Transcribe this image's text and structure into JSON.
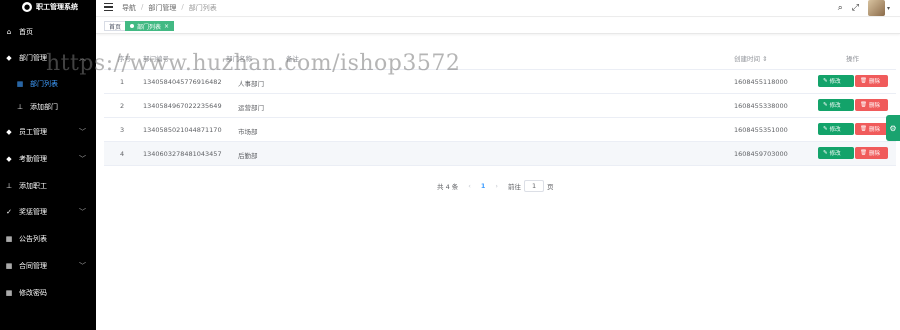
{
  "app": {
    "title": "职工管理系统"
  },
  "sidebar": {
    "items": [
      {
        "label": "首页",
        "icon": "home-icon",
        "glyph": "⌂"
      },
      {
        "label": "部门管理",
        "icon": "user-icon",
        "glyph": "👤"
      },
      {
        "label": "部门列表",
        "icon": "list-icon",
        "glyph": "▦"
      },
      {
        "label": "添加部门",
        "icon": "tree-icon",
        "glyph": "⊥"
      },
      {
        "label": "员工管理",
        "icon": "person-icon",
        "glyph": "👤"
      },
      {
        "label": "考勤管理",
        "icon": "person-icon",
        "glyph": "👤"
      },
      {
        "label": "添加职工",
        "icon": "tree-icon",
        "glyph": "⊥"
      },
      {
        "label": "奖惩管理",
        "icon": "check-icon",
        "glyph": "✓"
      },
      {
        "label": "公告列表",
        "icon": "grid-icon",
        "glyph": "▦"
      },
      {
        "label": "合同管理",
        "icon": "grid-icon",
        "glyph": "▦"
      },
      {
        "label": "修改密码",
        "icon": "grid-icon",
        "glyph": "▦"
      }
    ]
  },
  "header": {
    "breadcrumb": [
      "导航",
      "部门管理",
      "部门列表"
    ]
  },
  "tags": {
    "home": "首页",
    "active": "部门列表"
  },
  "table": {
    "columns": [
      "序号",
      "部门编号",
      "部门名称",
      "备注",
      "创建时间",
      "操作"
    ],
    "rows": [
      {
        "index": "1",
        "id": "1340584045776916482",
        "name": "人事部门",
        "note": "",
        "created": "1608455118000"
      },
      {
        "index": "2",
        "id": "1340584967022235649",
        "name": "运营部门",
        "note": "",
        "created": "1608455338000"
      },
      {
        "index": "3",
        "id": "1340585021044871170",
        "name": "市场部",
        "note": "",
        "created": "1608455351000"
      },
      {
        "index": "4",
        "id": "1340603278481043457",
        "name": "后勤部",
        "note": "",
        "created": "1608459703000"
      }
    ],
    "edit_label": "修改",
    "delete_label": "删除"
  },
  "pager": {
    "total": "共 4 条",
    "current": "1",
    "goto_prefix": "前往",
    "goto_value": "1",
    "goto_suffix": "页"
  },
  "watermark": "https://www.huzhan.com/ishop3572",
  "colors": {
    "accent": "#42b983",
    "edit": "#13a36a",
    "delete": "#f05b5b",
    "sidebar": "#000000",
    "active_sub": "#409eff"
  }
}
